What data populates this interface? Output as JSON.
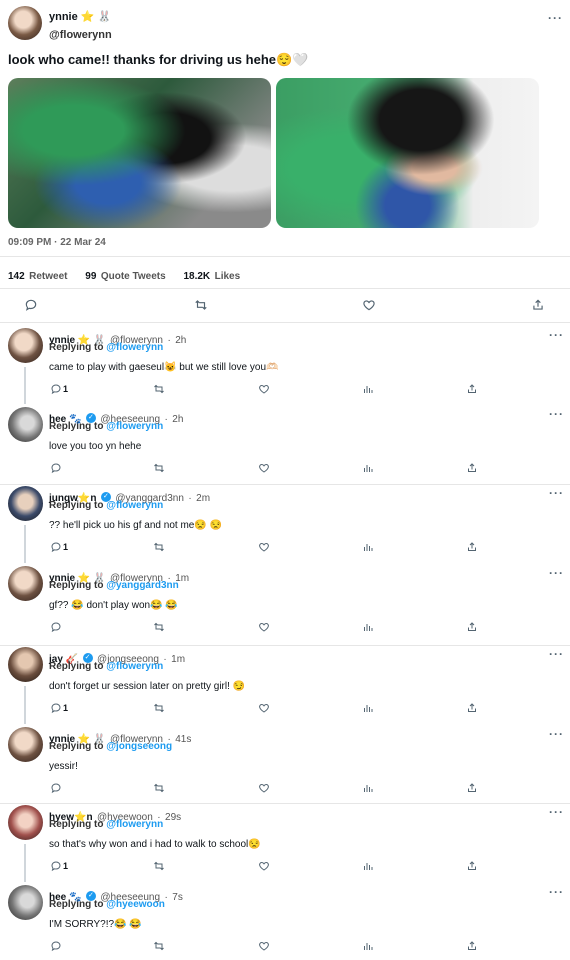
{
  "main": {
    "name": "ynnie ⭐ 🐰",
    "handle": "@flowerynn",
    "text": "look who came!! thanks for driving us hehe😌🤍",
    "time": "09:09 PM · 22 Mar 24",
    "stats": {
      "retweet_count": "142",
      "retweet_label": "Retweet",
      "quote_count": "99",
      "quote_label": "Quote Tweets",
      "likes_count": "18.2K",
      "likes_label": "Likes"
    }
  },
  "replies": [
    {
      "name": "ynnie ⭐ 🐰",
      "verified": false,
      "handle": "@flowerynn",
      "time": "2h",
      "replying_prefix": "Replying to",
      "replying_to": "@flowerynn",
      "text": "came to play with gaeseul😺  but we still love you🫶🏻",
      "reply_count": "1"
    },
    {
      "name": "hee 🐾",
      "verified": true,
      "handle": "@heeseeung",
      "time": "2h",
      "replying_prefix": "Replying to",
      "replying_to": "@flowerynn",
      "text": "love you too yn hehe",
      "reply_count": ""
    },
    {
      "name": "jungw⭐n",
      "verified": true,
      "handle": "@yanggard3nn",
      "time": "2m",
      "replying_prefix": "Replying to",
      "replying_to": "@flowerynn",
      "text": "?? he'll pick uo his gf and not me😒 😒",
      "reply_count": "1"
    },
    {
      "name": "ynnie ⭐ 🐰",
      "verified": false,
      "handle": "@flowerynn",
      "time": "1m",
      "replying_prefix": "Replying to",
      "replying_to": "@yanggard3nn",
      "text": "gf?? 😂  don't play won😂 😂",
      "reply_count": ""
    },
    {
      "name": "jay 🎸",
      "verified": true,
      "handle": "@jongseeong",
      "time": "1m",
      "replying_prefix": "Replying to",
      "replying_to": "@flowerynn",
      "text": "don't forget ur session later on pretty girl! 😏",
      "reply_count": "1"
    },
    {
      "name": "ynnie ⭐ 🐰",
      "verified": false,
      "handle": "@flowerynn",
      "time": "41s",
      "replying_prefix": "Replying to",
      "replying_to": "@jongseeong",
      "text": "yessir!",
      "reply_count": ""
    },
    {
      "name": "hyew⭐n",
      "verified": false,
      "handle": "@hyeewoon",
      "time": "29s",
      "replying_prefix": "Replying to",
      "replying_to": "@flowerynn",
      "text": "so that's why won and i had to walk to school😒",
      "reply_count": "1"
    },
    {
      "name": "hee 🐾",
      "verified": true,
      "handle": "@heeseeung",
      "time": "7s",
      "replying_prefix": "Replying to",
      "replying_to": "@hyeewoon",
      "text": "I'M SORRY?!?😂 😂",
      "reply_count": ""
    }
  ],
  "more_glyph": "···",
  "colors": {
    "link": "#1d9bf0",
    "icon": "#536471",
    "divider": "#e6e6e6"
  },
  "icons": [
    "reply-icon",
    "retweet-icon",
    "like-icon",
    "analytics-icon",
    "share-icon",
    "verified-icon",
    "more-icon"
  ]
}
